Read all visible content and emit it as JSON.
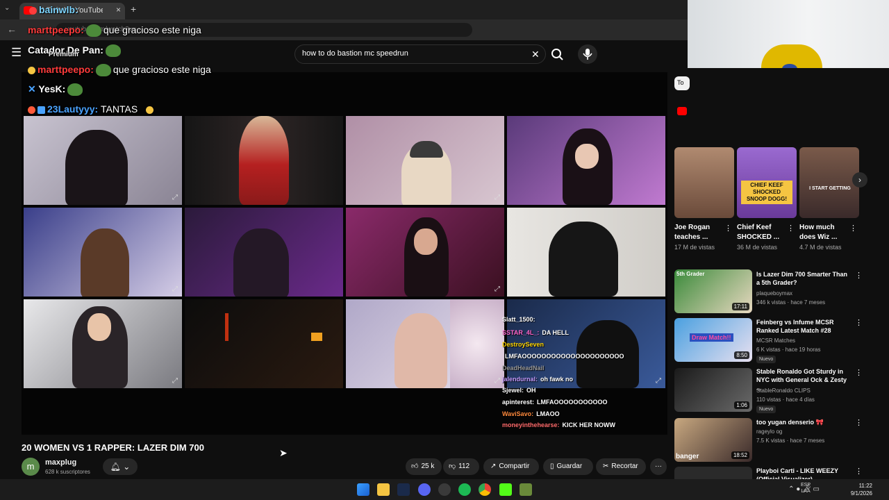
{
  "browser": {
    "tab_title": "0 Twitch • YouTube",
    "url_text": "youtube.com/watch?v=...",
    "new_tab": "+",
    "close_tab": "×"
  },
  "youtube": {
    "search_value": "how to do bastion mc speedrun",
    "video_title": "20 WOMEN VS 1 RAPPER: LAZER DIM 700",
    "channel": {
      "initial": "m",
      "name": "maxplug",
      "subscribers": "628 k suscriptores"
    },
    "likes": "25 k",
    "dislikes": "112",
    "share": "Compartir",
    "save": "Guardar",
    "clip": "Recortar",
    "more": "···",
    "filter_chip": "To"
  },
  "chat_overlay": [
    {
      "user": "bainwlb:",
      "color": "#7dd3fc",
      "msg": ""
    },
    {
      "user": "marttpeepo:",
      "color": "#ff3b3b",
      "msg": "que gracioso este niga"
    },
    {
      "user": "Catador De Pan:",
      "color": "#ffffff",
      "msg": ""
    },
    {
      "user": "Premium",
      "color": "#ffffff",
      "msg": ""
    },
    {
      "user": "marttpeepo:",
      "color": "#ff3b3b",
      "msg": "que gracioso este niga"
    },
    {
      "user": "YesK:",
      "color": "#ffffff",
      "msg": ""
    },
    {
      "user": "23Lautyyy:",
      "color": "#4aa3ff",
      "msg": "TANTAS"
    }
  ],
  "grid_chat": [
    {
      "user": "Slatt_1500:",
      "color": "#ffffff",
      "msg": ""
    },
    {
      "user": "SSTAR_4L_:",
      "color": "#ff66cc",
      "msg": "DA HELL"
    },
    {
      "user": "DestroySeven",
      "color": "#ffd400",
      "msg": ""
    },
    {
      "user": "",
      "color": "#ffffff",
      "msg": "LMFAOOOOOOOOOOOOOOOOOOOOO"
    },
    {
      "user": "DeadHeadNail",
      "color": "#999999",
      "msg": ""
    },
    {
      "user": "jalendurnal:",
      "color": "#c49bff",
      "msg": "oh fawk no"
    },
    {
      "user": "Sjewel:",
      "color": "#ffffff",
      "msg": "OH"
    },
    {
      "user": "apinterest:",
      "color": "#ffffff",
      "msg": "LMFAOOOOOOOOOOO"
    },
    {
      "user": "WaviSavo:",
      "color": "#ff8a3d",
      "msg": "LMAOO"
    },
    {
      "user": "moneyinthehearse:",
      "color": "#ff6b6b",
      "msg": "KICK HER NOWW"
    }
  ],
  "shorts": [
    {
      "title": "Joe Rogan teaches ...",
      "views": "17 M de vistas"
    },
    {
      "title": "Chief Keef SHOCKED ...",
      "views": "36 M de vistas",
      "thumb_text": "CHIEF KEEF SHOCKED SNOOP DOGG!"
    },
    {
      "title": "How much does Wiz ...",
      "views": "4.7 M de vistas",
      "thumb_text": "I START GETTING"
    }
  ],
  "related": [
    {
      "title": "Is Lazer Dim 700 Smarter Than a 5th Grader?",
      "channel": "plaqueboymax",
      "meta": "346 k vistas · hace 7 meses",
      "duration": "17:11",
      "badge": "",
      "thumb_text": "5th Grader"
    },
    {
      "title": "Feinberg vs Infume MCSR Ranked Latest Match #28",
      "channel": "MCSR Matches",
      "meta": "6 K vistas · hace 19 horas",
      "duration": "8:50",
      "badge": "Nuevo",
      "thumb_text": "Draw Match!!"
    },
    {
      "title": "Stable Ronaldo Got Sturdy in NYC with General Ock & Zesty ...",
      "channel": "StableRonaldo CLIPS",
      "meta": "110 vistas · hace 4 días",
      "duration": "1:06",
      "badge": "Nuevo",
      "thumb_text": ""
    },
    {
      "title": "too yugan denserio 🎀",
      "channel": "rageylo og",
      "meta": "7.5 K vistas · hace 7 meses",
      "duration": "18:52",
      "badge": "",
      "thumb_text": "banger"
    },
    {
      "title": "Playboi Carti - LIKE WEEZY (Official Visualizer)",
      "channel": "",
      "meta": "",
      "duration": "",
      "badge": "",
      "thumb_text": ""
    }
  ],
  "taskbar": {
    "lang_top": "ESP",
    "lang_bottom": "LAA",
    "time": "11:22",
    "date": "9/1/2026"
  },
  "colors": {
    "accent_red": "#ff0000",
    "bg": "#0f0f0f",
    "pill": "#272727"
  }
}
